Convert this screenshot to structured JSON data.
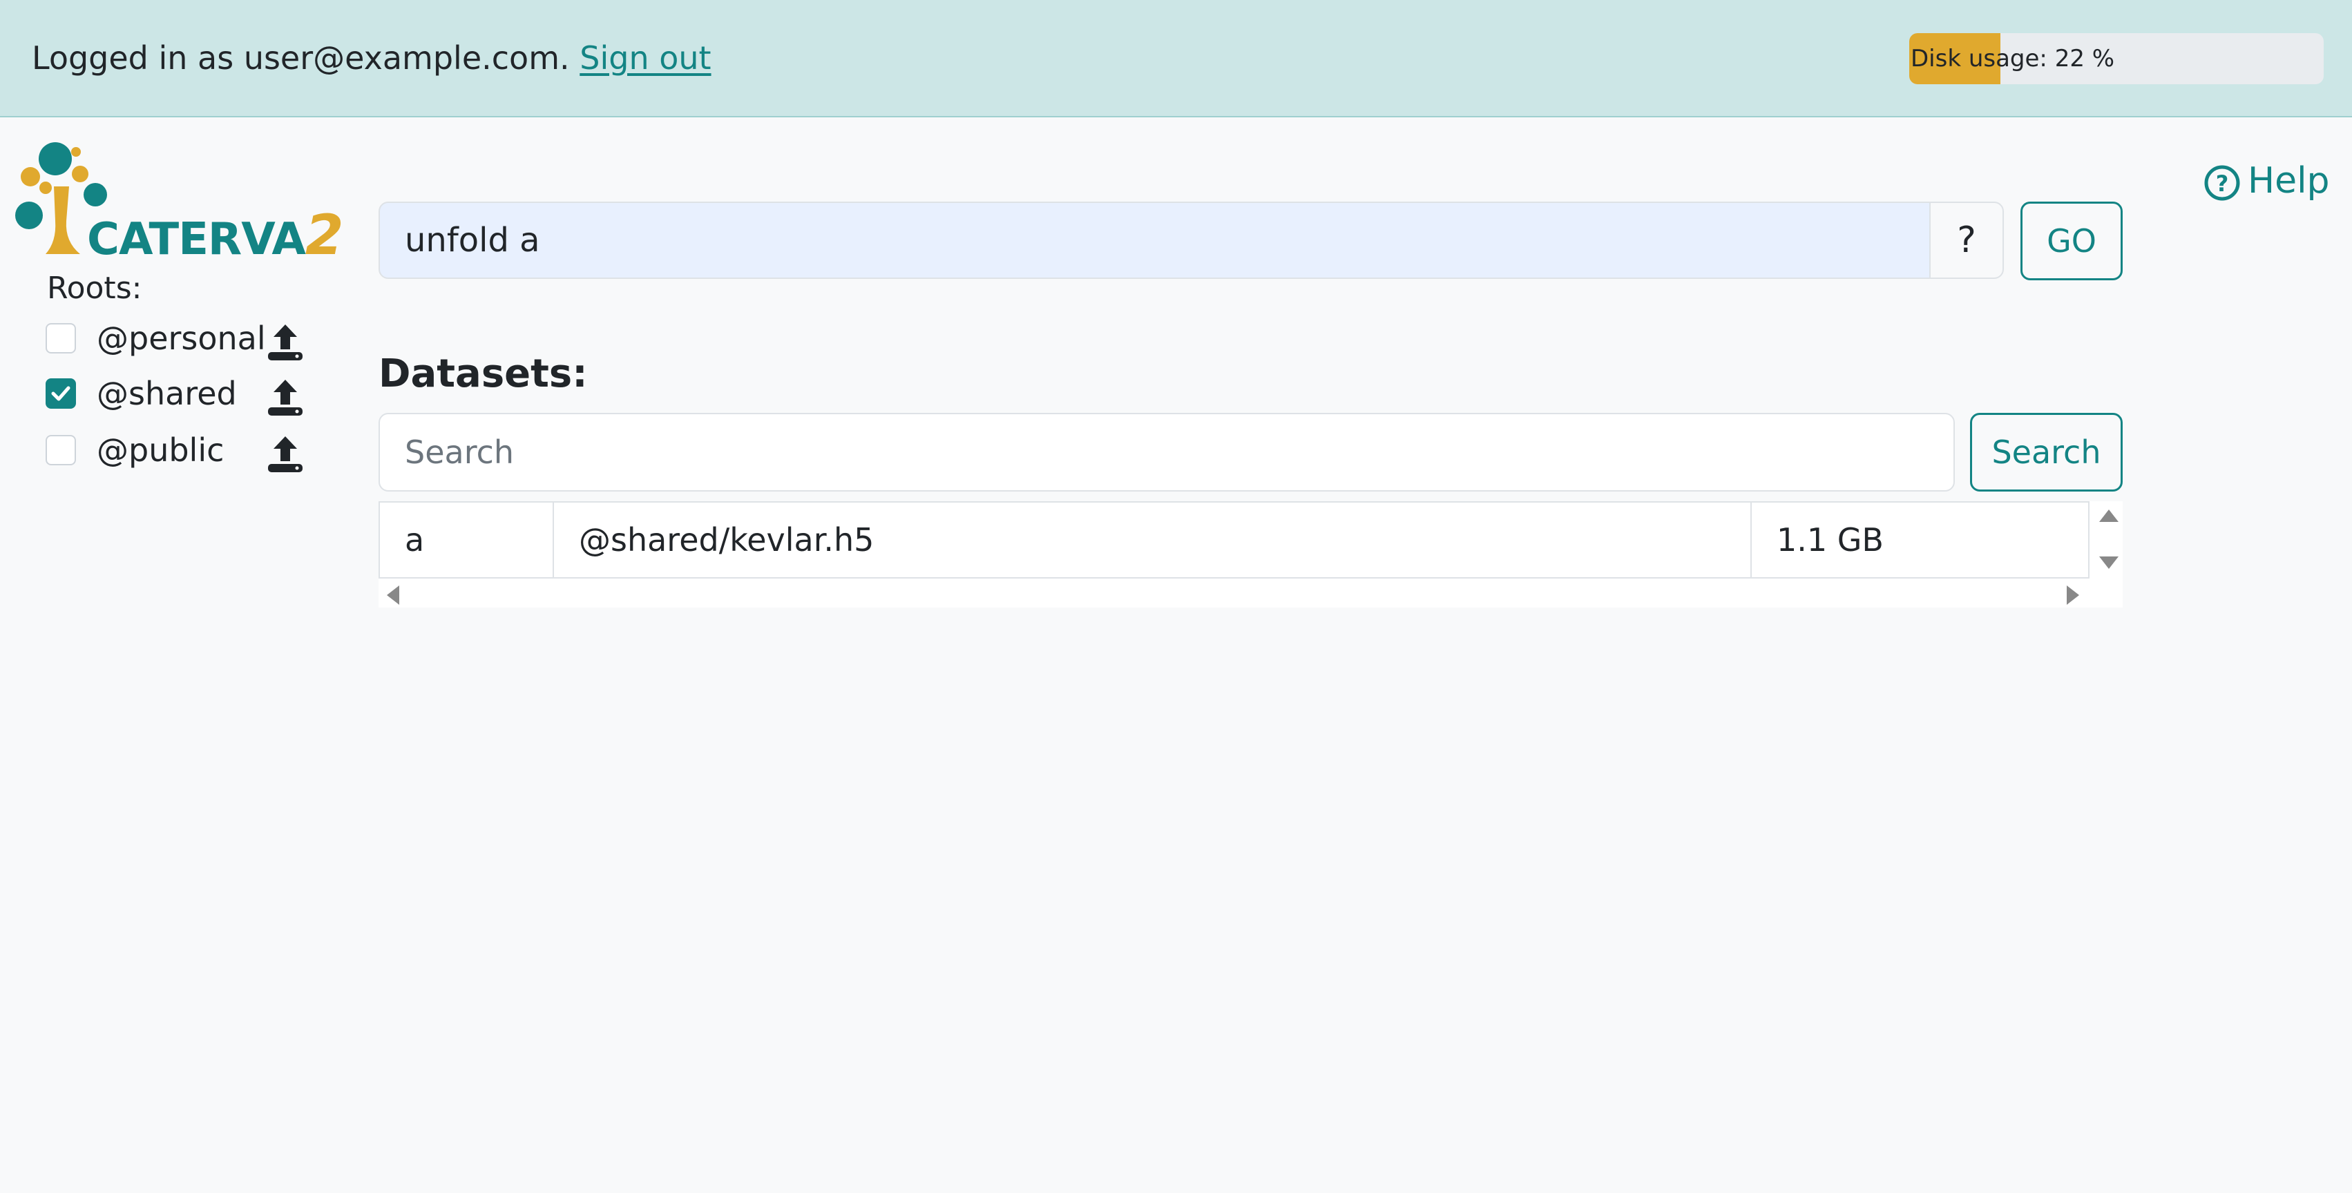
{
  "header": {
    "logged_in_prefix": "Logged in as user@example.com.",
    "sign_out_label": "Sign out",
    "disk_usage_label": "Disk usage: 22 %",
    "disk_usage_fraction": 0.22,
    "disk_usage_color": "#e0a92e"
  },
  "logo": {
    "word": "CATERVA",
    "suffix": "2"
  },
  "sidebar": {
    "roots_label": "Roots:",
    "roots": [
      {
        "name": "@personal",
        "checked": false
      },
      {
        "name": "@shared",
        "checked": true
      },
      {
        "name": "@public",
        "checked": false
      }
    ]
  },
  "help": {
    "label": "Help",
    "icon": "question-circle-icon"
  },
  "command": {
    "value": "unfold a",
    "help_label": "?",
    "go_label": "GO"
  },
  "datasets": {
    "title": "Datasets:",
    "search_placeholder": "Search",
    "search_button_label": "Search",
    "rows": [
      {
        "name": "a",
        "path": "@shared/kevlar.h5",
        "size": "1.1 GB"
      }
    ]
  },
  "colors": {
    "accent": "#138484",
    "topbar": "#cce6e6",
    "logo_gold": "#e0a92e"
  }
}
